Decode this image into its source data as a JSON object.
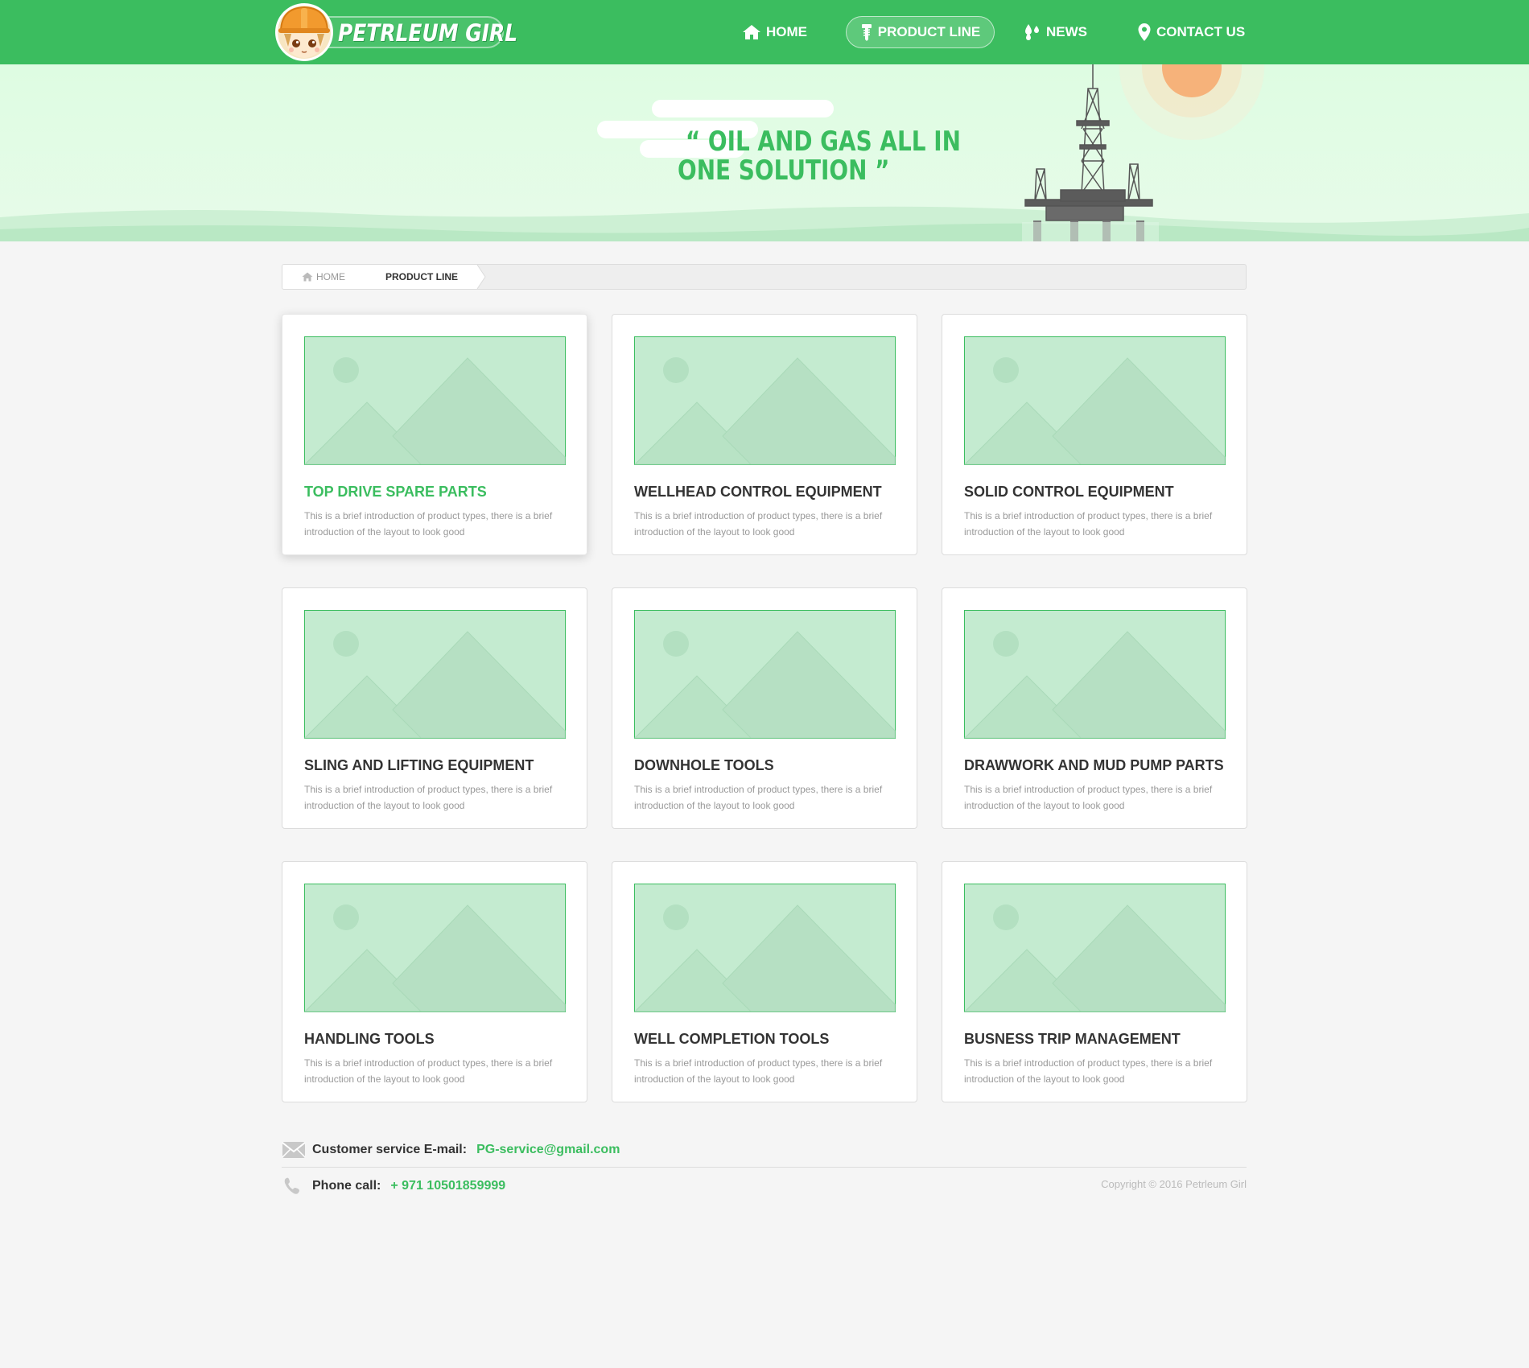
{
  "header": {
    "brand": "PETRLEUM GIRL",
    "nav": [
      {
        "label": "HOME",
        "icon": "home-icon"
      },
      {
        "label": "PRODUCT LINE",
        "icon": "screw-icon"
      },
      {
        "label": "NEWS",
        "icon": "oil-drops-icon"
      },
      {
        "label": "CONTACT US",
        "icon": "location-pin-icon"
      }
    ],
    "active_tab": "PRODUCT LINE"
  },
  "banner": {
    "slogan_line1": "“ OIL AND GAS ALL IN",
    "slogan_line2": "ONE SOLUTION ”"
  },
  "breadcrumb": {
    "home": "HOME",
    "current": "PRODUCT LINE"
  },
  "products": [
    {
      "title": "TOP DRIVE SPARE PARTS",
      "desc": "This is a brief introduction of product types, there is a brief introduction of the layout to look good"
    },
    {
      "title": "WELLHEAD CONTROL EQUIPMENT",
      "desc": "This is a brief introduction of product types, there is a brief introduction of the layout to look good"
    },
    {
      "title": "SOLID CONTROL EQUIPMENT",
      "desc": "This is a brief introduction of product types, there is a brief introduction of the layout to look good"
    },
    {
      "title": "SLING AND LIFTING EQUIPMENT",
      "desc": "This is a brief introduction of product types, there is a brief introduction of the layout to look good"
    },
    {
      "title": "DOWNHOLE TOOLS",
      "desc": "This is a brief introduction of product types, there is a brief introduction of the layout to look good"
    },
    {
      "title": "DRAWWORK AND MUD PUMP PARTS",
      "desc": "This is a brief introduction of product types, there is a brief introduction of the layout to look good"
    },
    {
      "title": "HANDLING TOOLS",
      "desc": "This is a brief introduction of product types, there is a brief introduction of the layout to look good"
    },
    {
      "title": "WELL COMPLETION TOOLS",
      "desc": "This is a brief introduction of product types, there is a brief introduction of the layout to look good"
    },
    {
      "title": "BUSNESS TRIP MANAGEMENT",
      "desc": "This is a brief introduction of product types, there is a brief introduction of the layout to look good"
    }
  ],
  "footer": {
    "email_label": "Customer service E-mail:",
    "email": "PG-service@gmail.com",
    "phone_label": "Phone call:",
    "phone": "+ 971 10501859999",
    "copyright": "Copyright  © 2016 Petrleum Girl"
  },
  "colors": {
    "brand_green": "#3bbd5f",
    "banner_bg": "#defce2",
    "placeholder_fill": "#c4ebd0",
    "placeholder_border": "#3bbd5f",
    "sun": "#f6b27a"
  }
}
